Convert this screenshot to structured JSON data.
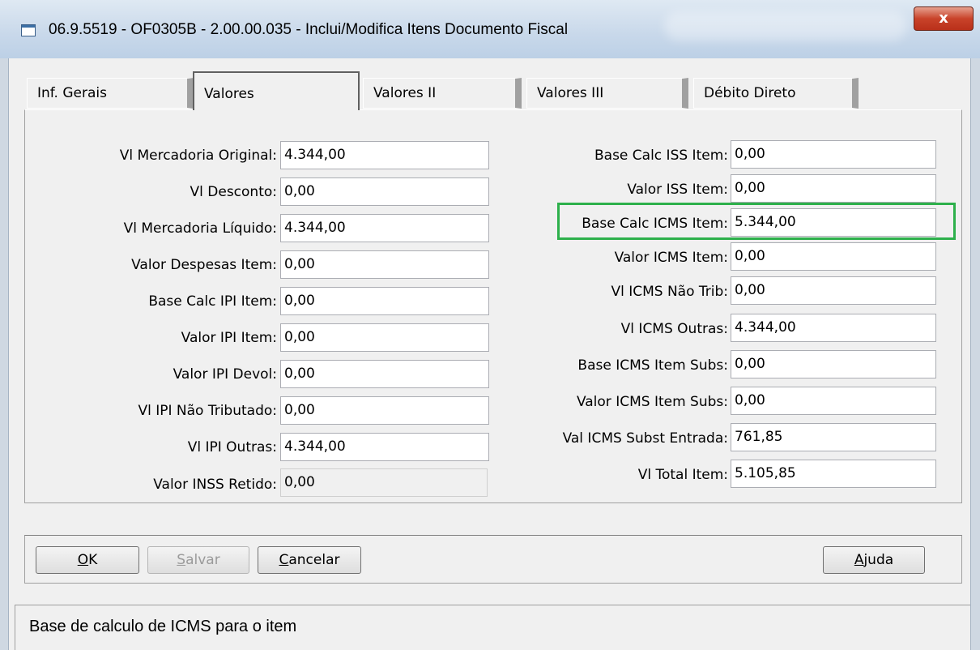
{
  "window": {
    "title": "06.9.5519 - OF0305B - 2.00.00.035 - Inclui/Modifica Itens Documento Fiscal",
    "close_label": "x"
  },
  "tabs": [
    {
      "label": "Inf. Gerais",
      "active": false
    },
    {
      "label": "Valores",
      "active": true
    },
    {
      "label": "Valores II",
      "active": false
    },
    {
      "label": "Valores III",
      "active": false
    },
    {
      "label": "Débito Direto",
      "active": false
    }
  ],
  "left_fields": [
    {
      "label": "Vl Mercadoria Original:",
      "value": "4.344,00"
    },
    {
      "label": "Vl Desconto:",
      "value": "0,00"
    },
    {
      "label": "Vl Mercadoria Líquido:",
      "value": "4.344,00"
    },
    {
      "label": "Valor Despesas Item:",
      "value": "0,00"
    },
    {
      "label": "Base Calc IPI Item:",
      "value": "0,00"
    },
    {
      "label": "Valor IPI Item:",
      "value": "0,00"
    },
    {
      "label": "Valor IPI Devol:",
      "value": "0,00"
    },
    {
      "label": "Vl IPI Não Tributado:",
      "value": "0,00"
    },
    {
      "label": "Vl IPI Outras:",
      "value": "4.344,00"
    },
    {
      "label": "Valor INSS Retido:",
      "value": "0,00",
      "disabled": true
    }
  ],
  "right_fields": [
    {
      "label": "Base Calc ISS Item:",
      "value": "0,00"
    },
    {
      "label": "Valor ISS Item:",
      "value": "0,00"
    },
    {
      "label": "Base Calc ICMS Item:",
      "value": "5.344,00",
      "highlighted": true
    },
    {
      "label": "Valor ICMS Item:",
      "value": "0,00"
    },
    {
      "label": "Vl ICMS Não Trib:",
      "value": "0,00"
    },
    {
      "label": "Vl ICMS Outras:",
      "value": "4.344,00"
    },
    {
      "label": "Base ICMS Item Subs:",
      "value": "0,00"
    },
    {
      "label": "Valor ICMS Item Subs:",
      "value": "0,00"
    },
    {
      "label": "Val ICMS Subst Entrada:",
      "value": "761,85"
    },
    {
      "label": "Vl Total Item:",
      "value": "5.105,85"
    }
  ],
  "buttons": {
    "ok": {
      "underline": "O",
      "rest": "K"
    },
    "salvar": {
      "underline": "S",
      "rest": "alvar",
      "disabled": true
    },
    "cancelar": {
      "underline": "C",
      "rest": "ancelar"
    },
    "ajuda": {
      "underline": "A",
      "rest": "juda"
    }
  },
  "status_bar": {
    "text": "Base de calculo de ICMS para o item"
  },
  "colors": {
    "highlight_border": "#2db04b",
    "close_button": "#c9432a"
  },
  "icons": {
    "app": "app-window-icon",
    "close": "close-icon"
  }
}
